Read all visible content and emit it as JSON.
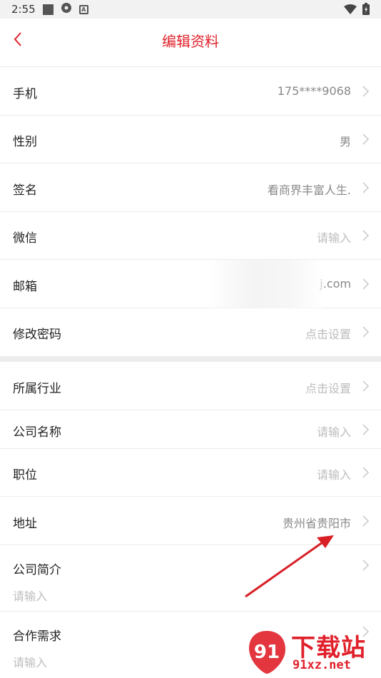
{
  "status_bar": {
    "time": "2:55"
  },
  "header": {
    "title": "编辑资料"
  },
  "rows": [
    {
      "label": "手机",
      "value": "175****9068"
    },
    {
      "label": "性别",
      "value": "男"
    },
    {
      "label": "签名",
      "value": "看商界丰富人生."
    },
    {
      "label": "微信",
      "placeholder": "请输入"
    },
    {
      "label": "邮箱",
      "value": "j.com"
    },
    {
      "label": "修改密码",
      "placeholder": "点击设置"
    },
    {
      "label": "所属行业",
      "placeholder": "点击设置"
    },
    {
      "label": "公司名称",
      "placeholder": "请输入"
    },
    {
      "label": "职位",
      "placeholder": "请输入"
    },
    {
      "label": "地址",
      "value": "贵州省贵阳市"
    },
    {
      "label": "公司简介",
      "placeholder": "请输入"
    },
    {
      "label": "合作需求",
      "placeholder": "请输入"
    }
  ],
  "watermark": {
    "brand": "下载站",
    "url": "91xz.net",
    "logo_text": "91"
  },
  "colors": {
    "accent": "#e0202a",
    "annotation_arrow": "#d81f26"
  }
}
